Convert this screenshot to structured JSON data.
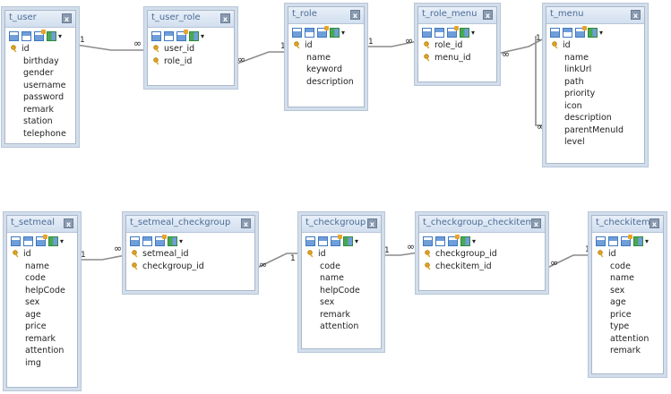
{
  "tables": [
    {
      "name": "t_user",
      "primary_key": "id",
      "fields": [
        "birthday",
        "gender",
        "username",
        "password",
        "remark",
        "station",
        "telephone"
      ]
    },
    {
      "name": "t_user_role",
      "primary_key": [
        "user_id",
        "role_id"
      ],
      "fields": []
    },
    {
      "name": "t_role",
      "primary_key": "id",
      "fields": [
        "name",
        "keyword",
        "description"
      ]
    },
    {
      "name": "t_role_menu",
      "primary_key": [
        "role_id",
        "menu_id"
      ],
      "fields": []
    },
    {
      "name": "t_menu",
      "primary_key": "id",
      "fields": [
        "name",
        "linkUrl",
        "path",
        "priority",
        "icon",
        "description",
        "parentMenuId",
        "level"
      ]
    },
    {
      "name": "t_setmeal",
      "primary_key": "id",
      "fields": [
        "name",
        "code",
        "helpCode",
        "sex",
        "age",
        "price",
        "remark",
        "attention",
        "img"
      ]
    },
    {
      "name": "t_setmeal_checkgroup",
      "primary_key": [
        "setmeal_id",
        "checkgroup_id"
      ],
      "fields": []
    },
    {
      "name": "t_checkgroup",
      "primary_key": "id",
      "fields": [
        "code",
        "name",
        "helpCode",
        "sex",
        "remark",
        "attention"
      ]
    },
    {
      "name": "t_checkgroup_checkitem",
      "primary_key": [
        "checkgroup_id",
        "checkitem_id"
      ],
      "fields": []
    },
    {
      "name": "t_checkitem",
      "primary_key": "id",
      "fields": [
        "code",
        "name",
        "sex",
        "age",
        "price",
        "type",
        "attention",
        "remark"
      ]
    }
  ],
  "relationships": [
    {
      "from": "t_user",
      "to": "t_user_role",
      "from_card": "1",
      "to_card": "∞"
    },
    {
      "from": "t_role",
      "to": "t_user_role",
      "from_card": "1",
      "to_card": "∞"
    },
    {
      "from": "t_role",
      "to": "t_role_menu",
      "from_card": "1",
      "to_card": "∞"
    },
    {
      "from": "t_menu",
      "to": "t_role_menu",
      "from_card": "1",
      "to_card": "∞"
    },
    {
      "from": "t_menu",
      "to": "t_menu",
      "from_card": "1",
      "to_card": "∞"
    },
    {
      "from": "t_setmeal",
      "to": "t_setmeal_checkgroup",
      "from_card": "1",
      "to_card": "∞"
    },
    {
      "from": "t_checkgroup",
      "to": "t_setmeal_checkgroup",
      "from_card": "1",
      "to_card": "∞"
    },
    {
      "from": "t_checkgroup",
      "to": "t_checkgroup_checkitem",
      "from_card": "1",
      "to_card": "∞"
    },
    {
      "from": "t_checkitem",
      "to": "t_checkgroup_checkitem",
      "from_card": "1",
      "to_card": "∞"
    }
  ],
  "labels": {
    "one": "1",
    "many": "∞",
    "close": "x",
    "dropdown": "▾"
  },
  "colors": {
    "border": "#a9b8cc",
    "frame": "#d3deeb",
    "title": "#4a6c97",
    "line": "#8c8c8c",
    "key": "#e0a21a"
  }
}
